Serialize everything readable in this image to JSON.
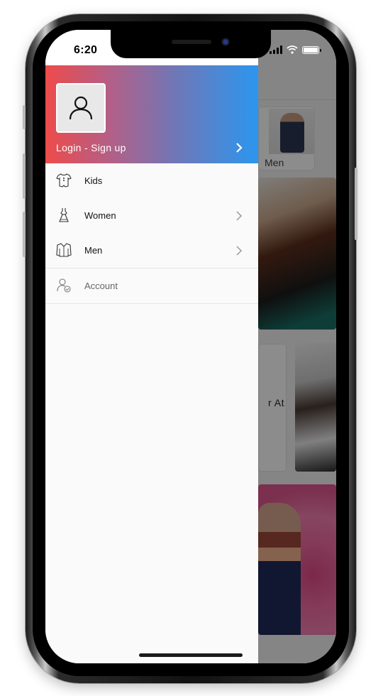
{
  "status_bar": {
    "time": "6:20"
  },
  "drawer": {
    "header": {
      "login_label": "Login - Sign up",
      "gradient_start": "#ee4b4b",
      "gradient_end": "#2b96ef"
    },
    "menu": [
      {
        "label": "Kids",
        "icon": "onesie-icon",
        "has_chevron": false
      },
      {
        "label": "Women",
        "icon": "dress-icon",
        "has_chevron": true
      },
      {
        "label": "Men",
        "icon": "shirt-icon",
        "has_chevron": true
      },
      {
        "label": "Account",
        "icon": "user-check-icon",
        "has_chevron": false
      }
    ]
  },
  "background_page": {
    "men_card_label": "Men",
    "promo_text_fragment": "r At"
  }
}
